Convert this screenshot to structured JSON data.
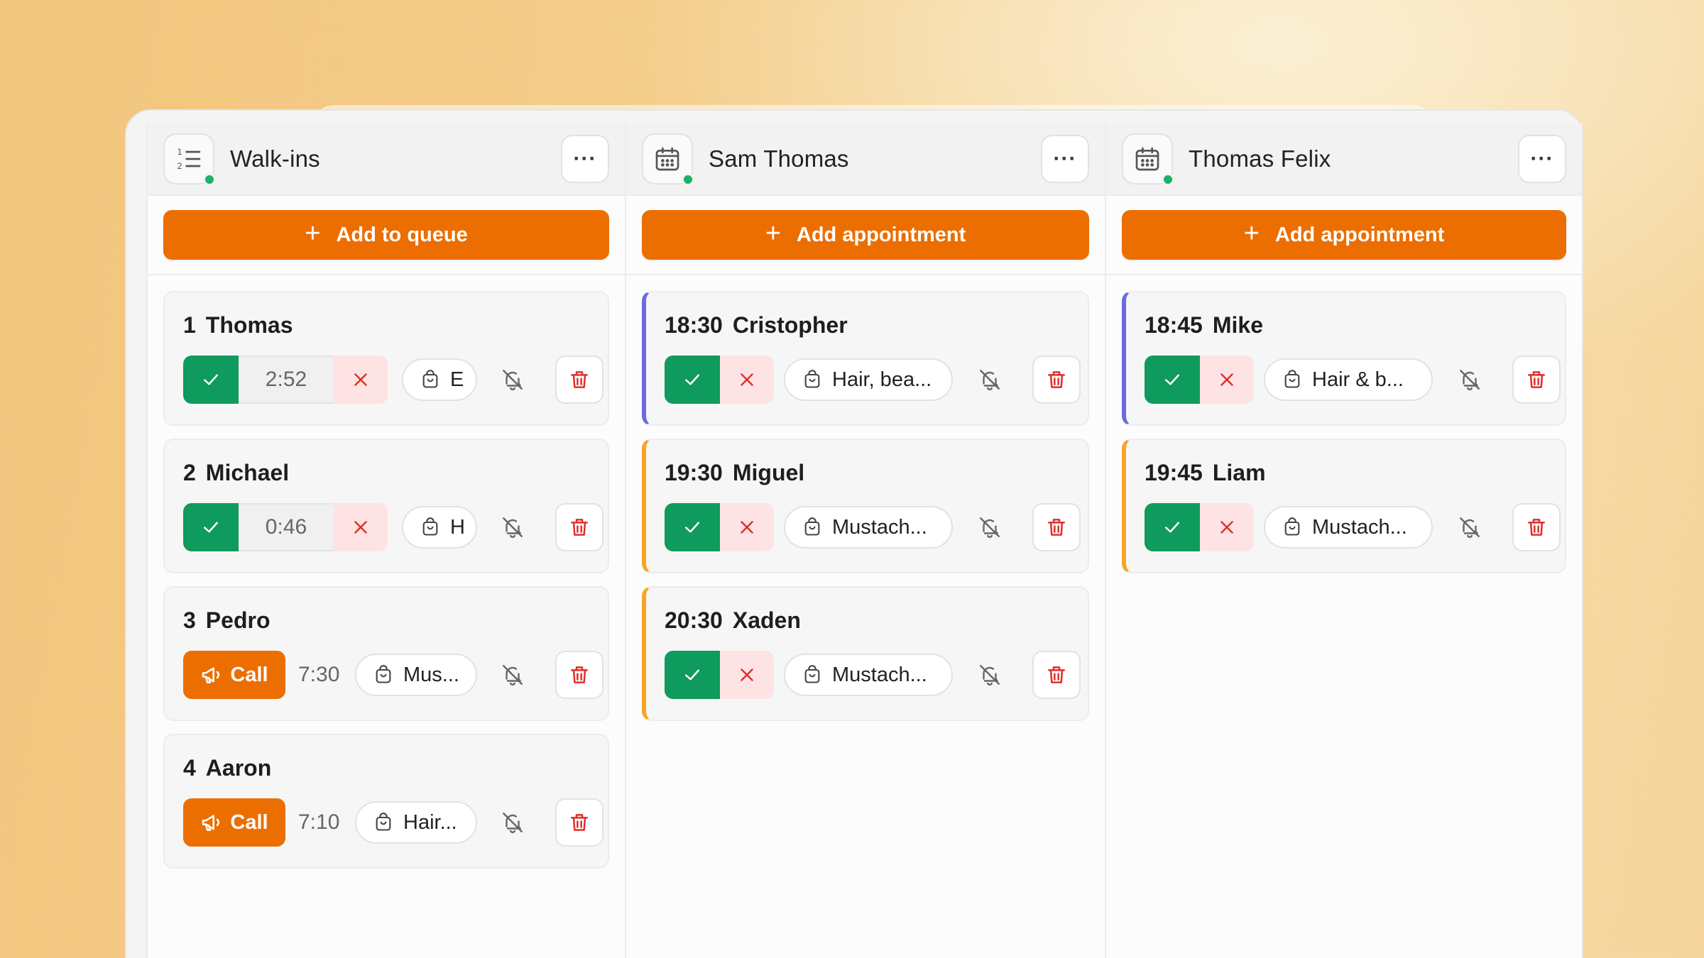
{
  "columns": [
    {
      "title": "Walk-ins",
      "icon": "numbered-list-icon",
      "add_label": "Add to queue",
      "cards": [
        {
          "num": "1",
          "name": "Thomas",
          "timer": "2:52",
          "service": "E"
        },
        {
          "num": "2",
          "name": "Michael",
          "timer": "0:46",
          "service": "H"
        },
        {
          "num": "3",
          "name": "Pedro",
          "call_label": "Call",
          "time": "7:30",
          "service": "Mus..."
        },
        {
          "num": "4",
          "name": "Aaron",
          "call_label": "Call",
          "time": "7:10",
          "service": "Hair..."
        }
      ]
    },
    {
      "title": "Sam Thomas",
      "icon": "calendar-icon",
      "add_label": "Add appointment",
      "cards": [
        {
          "time": "18:30",
          "name": "Cristopher",
          "service": "Hair, bea...",
          "accent": "#6b6be0"
        },
        {
          "time": "19:30",
          "name": "Miguel",
          "service": "Mustach...",
          "accent": "#f5a623"
        },
        {
          "time": "20:30",
          "name": "Xaden",
          "service": "Mustach...",
          "accent": "#f5a623"
        }
      ]
    },
    {
      "title": "Thomas Felix",
      "icon": "calendar-icon",
      "add_label": "Add appointment",
      "cards": [
        {
          "time": "18:45",
          "name": "Mike",
          "service": "Hair & b...",
          "accent": "#6b6be0"
        },
        {
          "time": "19:45",
          "name": "Liam",
          "service": "Mustach...",
          "accent": "#f5a623"
        }
      ]
    }
  ],
  "more_label": "···",
  "plus_glyph": "+",
  "colors": {
    "primary_orange": "#ec6e00",
    "confirm_green": "#0f9a5e",
    "cancel_red": "#e0302c",
    "online_dot": "#1bb26b"
  }
}
